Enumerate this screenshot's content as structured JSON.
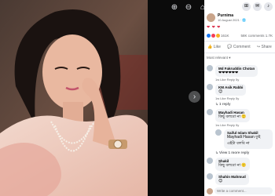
{
  "viewer": {
    "tools": [
      "zoom-in",
      "zoom-out",
      "tag",
      "fullscreen"
    ],
    "next_label": "›"
  },
  "topbar": {
    "icons": [
      "grid-icon",
      "messenger-icon",
      "bell-icon"
    ]
  },
  "post": {
    "author": "Purnima",
    "date": "10 August 2021 · 🌐",
    "caption": "❤ ❤ ❤",
    "reaction_count": "161K",
    "comment_share": "58K comments  1.7K",
    "actions": {
      "like": "Like",
      "comment": "Comment",
      "share": "Share"
    },
    "filter": "Most relevant ▾"
  },
  "comments": [
    {
      "name": "Md Fakruddin Chotan",
      "text": "❤❤❤❤❤❤",
      "meta": "1w  Like  Reply  5y"
    },
    {
      "name": "KM Asik Rabbi",
      "text": "😊",
      "meta": "1w  Like  Reply  5y"
    },
    {
      "link": "↳ 1 reply"
    },
    {
      "name": "Mayhadi Hasan",
      "text": "কিছু বলবো না 🙂",
      "meta": "1w  Like  Reply  5y"
    },
    {
      "name": "Saiful Islam Shakil",
      "text": "Mayhadi Hasan তুই এইটা বলবি না",
      "meta": "Like  Reply  5y",
      "reply": true
    },
    {
      "link": "↳ View 1 more reply"
    },
    {
      "name": "Shakil",
      "text": "কিছু বলবো না 🙂",
      "meta": "1w  Like  Reply  5y"
    },
    {
      "name": "Shahin Mahmud",
      "text": "😊",
      "meta": "Like  Reply  1y"
    }
  ],
  "composer": {
    "placeholder": "Write a comment..."
  },
  "colors": {
    "accent": "#1877f2",
    "like": "#1877f2",
    "love": "#f33e58",
    "haha": "#f7b125"
  }
}
